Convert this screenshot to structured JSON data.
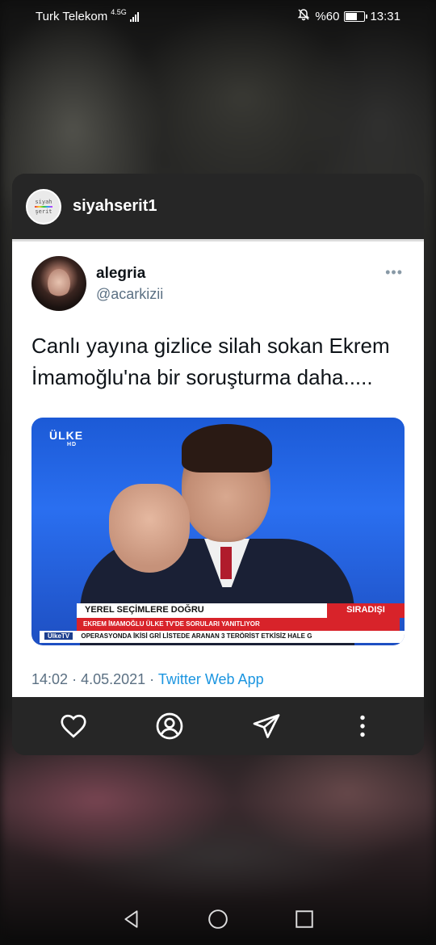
{
  "status_bar": {
    "carrier": "Turk Telekom",
    "network_type": "4.5G",
    "battery_percent": "%60",
    "time": "13:31",
    "battery_level": 0.6
  },
  "post": {
    "account": "siyahserit1",
    "avatar_text_line1": "siyah",
    "avatar_text_line2": "şerit"
  },
  "tweet": {
    "display_name": "alegria",
    "handle": "@acarkizii",
    "more": "•••",
    "text": "Canlı yayına gizlice silah sokan Ekrem İmamoğlu'na bir soruşturma daha.....",
    "media": {
      "channel_logo": "ÜLKE",
      "channel_logo_sub": "HD",
      "lower_third_title": "YEREL SEÇİMLERE DOĞRU",
      "lower_third_tag": "SIRADIŞI",
      "lower_third_subtitle": "EKREM İMAMOĞLU ÜLKE TV'DE SORULARI YANITLIYOR",
      "ticker_source": "ÜlkeTV",
      "ticker_text": "OPERASYONDA İKİSİ GRİ LİSTEDE ARANAN 3 TERÖRİST ETKİSİZ HALE G"
    },
    "time": "14:02",
    "date": "4.05.2021",
    "separator": "·",
    "app": "Twitter Web App"
  },
  "actions": {
    "icons": [
      "heart-icon",
      "profile-icon",
      "send-icon",
      "more-vertical-icon"
    ]
  },
  "nav": {
    "icons": [
      "back-icon",
      "home-icon",
      "recents-icon"
    ]
  },
  "colors": {
    "card_bg": "#262626",
    "link": "#1b95e0",
    "muted": "#5b7083",
    "media_blue": "#2a6ff0",
    "news_red": "#d8232a"
  }
}
